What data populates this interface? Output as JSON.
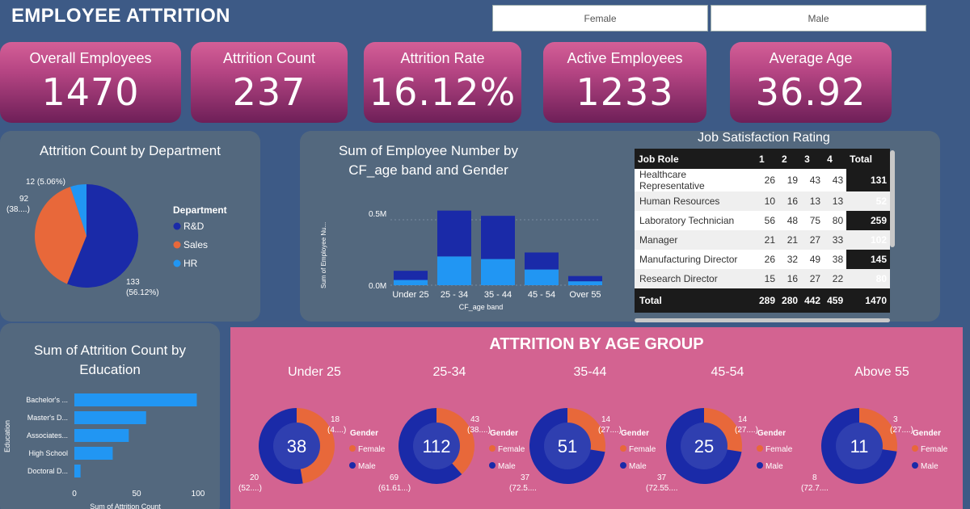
{
  "header": {
    "title": "EMPLOYEE ATTRITION",
    "slicers": [
      "Female",
      "Male"
    ]
  },
  "kpis": [
    {
      "label": "Overall Employees",
      "value": "1470"
    },
    {
      "label": "Attrition Count",
      "value": "237"
    },
    {
      "label": "Attrition Rate",
      "value": "16.12%"
    },
    {
      "label": "Active Employees",
      "value": "1233"
    },
    {
      "label": "Average Age",
      "value": "36.92"
    }
  ],
  "colors": {
    "rd": "#1a2aa8",
    "sales": "#e8683a",
    "hr": "#2196f3",
    "female": "#e8683a",
    "male": "#1a2aa8",
    "light": "#2196f3"
  },
  "chart_data": [
    {
      "type": "pie",
      "title": "Attrition Count by Department",
      "legend_title": "Department",
      "slices": [
        {
          "label": "R&D",
          "value": 133,
          "pct_label": "133",
          "pct_sub": "(56.12%)"
        },
        {
          "label": "Sales",
          "value": 92,
          "pct_label": "92",
          "pct_sub": "(38....)"
        },
        {
          "label": "HR",
          "value": 12,
          "pct_label": "12 (5.06%)",
          "pct_sub": ""
        }
      ]
    },
    {
      "type": "bar",
      "stacked": true,
      "title": "Sum of Employee Number by CF_age band and Gender",
      "xlabel": "CF_age band",
      "ylabel": "Sum of Employee Nu...",
      "yticks": [
        "0.0M",
        "0.5M"
      ],
      "ylim": [
        0,
        0.75
      ],
      "categories": [
        "Under 25",
        "25 - 34",
        "35 - 44",
        "45 - 54",
        "Over 55"
      ],
      "series": [
        {
          "values": [
            0.04,
            0.22,
            0.2,
            0.12,
            0.03
          ]
        },
        {
          "values": [
            0.07,
            0.35,
            0.33,
            0.13,
            0.04
          ]
        }
      ]
    },
    {
      "type": "bar",
      "orientation": "horizontal",
      "title": "Sum of Attrition Count by Education",
      "xlabel": "Sum of Attrition Count",
      "ylabel": "Education",
      "xticks": [
        "0",
        "50",
        "100"
      ],
      "xlim": [
        0,
        100
      ],
      "categories": [
        "Bachelor's ...",
        "Master's D...",
        "Associates...",
        "High School",
        "Doctoral D..."
      ],
      "values": [
        99,
        58,
        44,
        31,
        5
      ]
    },
    {
      "type": "table",
      "title": "Job Satisfaction Rating",
      "columns": [
        "Job Role",
        "1",
        "2",
        "3",
        "4",
        "Total"
      ],
      "rows": [
        [
          "Healthcare Representative",
          "26",
          "19",
          "43",
          "43",
          "131"
        ],
        [
          "Human Resources",
          "10",
          "16",
          "13",
          "13",
          "52"
        ],
        [
          "Laboratory Technician",
          "56",
          "48",
          "75",
          "80",
          "259"
        ],
        [
          "Manager",
          "21",
          "21",
          "27",
          "33",
          "102"
        ],
        [
          "Manufacturing Director",
          "26",
          "32",
          "49",
          "38",
          "145"
        ],
        [
          "Research Director",
          "15",
          "16",
          "27",
          "22",
          "80"
        ]
      ],
      "total": [
        "Total",
        "289",
        "280",
        "442",
        "459",
        "1470"
      ]
    },
    {
      "type": "pie",
      "donut": true,
      "title": "ATTRITION BY AGE GROUP",
      "legend_title": "Gender",
      "legend": [
        "Female",
        "Male"
      ],
      "groups": [
        {
          "name": "Under 25",
          "center": "38",
          "female": 18,
          "male": 20,
          "f_label": "18",
          "f_sub": "(4....)",
          "m_label": "20",
          "m_sub": "(52....)"
        },
        {
          "name": "25-34",
          "center": "112",
          "female": 43,
          "male": 69,
          "f_label": "43",
          "f_sub": "(38....)",
          "m_label": "69",
          "m_sub": "(61.61...)"
        },
        {
          "name": "35-44",
          "center": "51",
          "female": 14,
          "male": 37,
          "f_label": "14",
          "f_sub": "(27....)",
          "m_label": "37",
          "m_sub": "(72.5...."
        },
        {
          "name": "45-54",
          "center": "25",
          "female": 14,
          "male": 37,
          "f_label": "14",
          "f_sub": "(27....)",
          "m_label": "37",
          "m_sub": "(72.55...."
        },
        {
          "name": "Above 55",
          "center": "11",
          "female": 3,
          "male": 8,
          "f_label": "3",
          "f_sub": "(27....)",
          "m_label": "8",
          "m_sub": "(72.7...."
        }
      ]
    }
  ]
}
